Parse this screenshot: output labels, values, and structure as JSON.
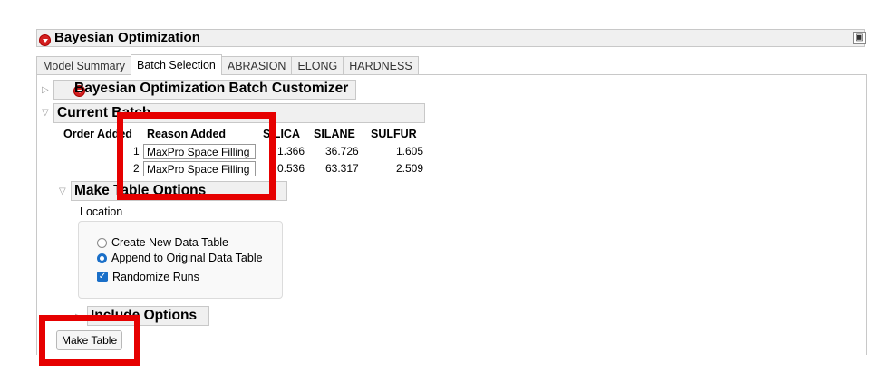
{
  "header": {
    "title": "Bayesian Optimization"
  },
  "tabs": [
    "Model Summary",
    "Batch Selection",
    "ABRASION",
    "ELONG",
    "HARDNESS"
  ],
  "customizer": {
    "title": "Bayesian Optimization Batch Customizer"
  },
  "current_batch": {
    "title": "Current Batch",
    "columns": [
      "Order Added",
      "Reason Added",
      "SILICA",
      "SILANE",
      "SULFUR"
    ],
    "rows": [
      {
        "order": "1",
        "reason": "MaxPro Space Filling",
        "silica": "1.366",
        "silane": "36.726",
        "sulfur": "1.605"
      },
      {
        "order": "2",
        "reason": "MaxPro Space Filling",
        "silica": "0.536",
        "silane": "63.317",
        "sulfur": "2.509"
      }
    ]
  },
  "make_table_options": {
    "title": "Make Table Options",
    "location_label": "Location",
    "option_create": "Create New Data Table",
    "option_append": "Append to Original Data Table",
    "option_randomize": "Randomize Runs",
    "selected": "Append to Original Data Table",
    "randomize_checked": true
  },
  "include_options": {
    "title": "Include Options"
  },
  "make_table_button": "Make Table",
  "colors": {
    "accent": "#1a6fc8",
    "highlight": "#e60000",
    "disclosure": "#d42020"
  }
}
